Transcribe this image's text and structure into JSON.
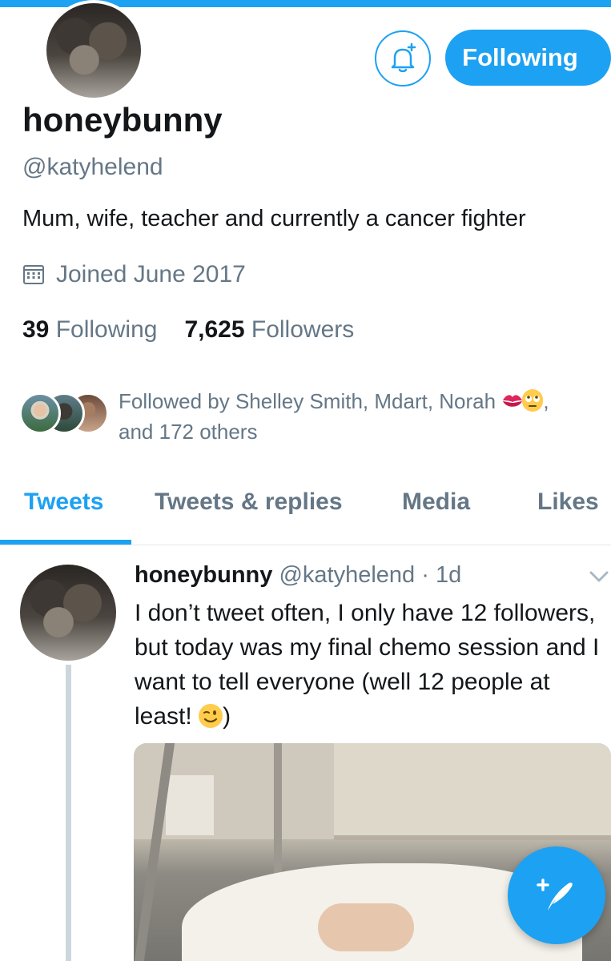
{
  "profile": {
    "display_name": "honeybunny",
    "handle": "@katyhelend",
    "bio": "Mum, wife, teacher and currently a cancer fighter",
    "joined": "Joined June 2017",
    "following_count": "39",
    "following_label": "Following",
    "followers_count": "7,625",
    "followers_label": "Followers"
  },
  "actions": {
    "notify_icon": "bell-plus-icon",
    "follow_button_label": "Following"
  },
  "followed_by": {
    "line1": "Followed by Shelley Smith, Mdart, Norah",
    "emojis": [
      "kiss-mark-emoji",
      "face-with-rolling-eyes-emoji"
    ],
    "line1_end": ",",
    "line2": "and 172 others"
  },
  "tabs": [
    {
      "label": "Tweets",
      "active": true
    },
    {
      "label": "Tweets & replies",
      "active": false
    },
    {
      "label": "Media",
      "active": false
    },
    {
      "label": "Likes",
      "active": false
    }
  ],
  "tweet": {
    "name": "honeybunny",
    "handle": "@katyhelend",
    "separator": "·",
    "time": "1d",
    "text": "I don’t tweet often, I only have 12 followers, but today was my final chemo session and I want to tell everyone (well 12 people at least!",
    "text_emoji": "winking-face-emoji",
    "text_end": ")"
  },
  "colors": {
    "accent": "#1da1f2",
    "secondary_text": "#657786",
    "primary_text": "#14171a"
  },
  "fab_icon": "compose-tweet-icon"
}
